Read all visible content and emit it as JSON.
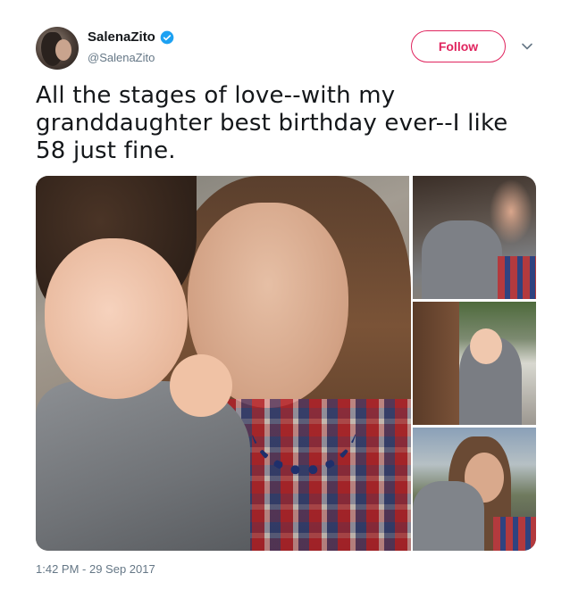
{
  "user": {
    "display_name": "SalenaZito",
    "handle": "@SalenaZito",
    "verified": true
  },
  "actions": {
    "follow_label": "Follow"
  },
  "tweet": {
    "text": "All the stages of love--with my granddaughter best birthday ever--I like 58 just fine.",
    "timestamp": "1:42 PM - 29 Sep 2017"
  },
  "colors": {
    "accent": "#e0245e",
    "verified": "#1da1f2",
    "text": "#14171a",
    "muted": "#657786"
  },
  "icons": {
    "verified": "verified-badge-icon",
    "menu": "chevron-down-icon"
  }
}
